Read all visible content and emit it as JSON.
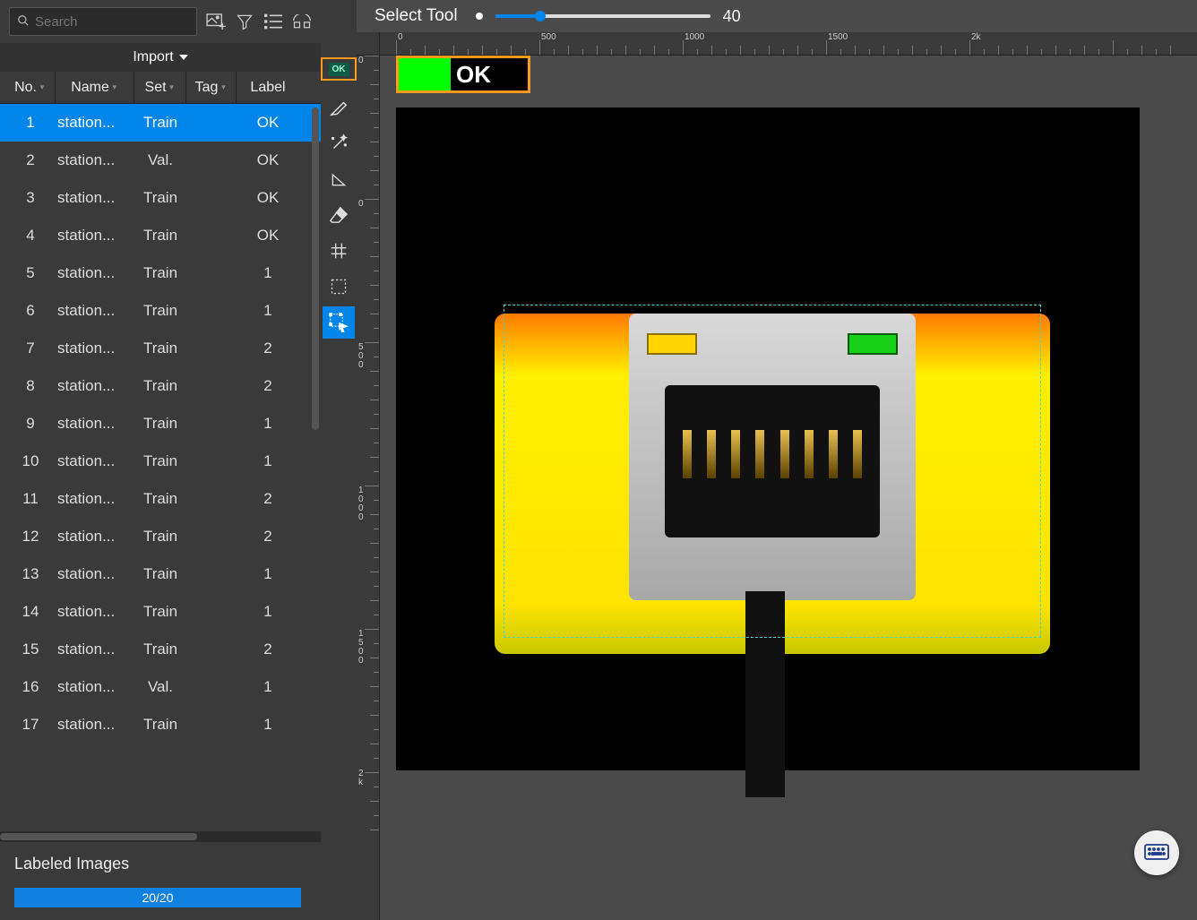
{
  "search": {
    "placeholder": "Search"
  },
  "import_label": "Import",
  "columns": {
    "no": "No.",
    "name": "Name",
    "set": "Set",
    "tag": "Tag",
    "label": "Label"
  },
  "rows": [
    {
      "no": 1,
      "name": "station...",
      "set": "Train",
      "tag": "",
      "label": "OK",
      "selected": true
    },
    {
      "no": 2,
      "name": "station...",
      "set": "Val.",
      "tag": "",
      "label": "OK"
    },
    {
      "no": 3,
      "name": "station...",
      "set": "Train",
      "tag": "",
      "label": "OK"
    },
    {
      "no": 4,
      "name": "station...",
      "set": "Train",
      "tag": "",
      "label": "OK"
    },
    {
      "no": 5,
      "name": "station...",
      "set": "Train",
      "tag": "",
      "label": "1"
    },
    {
      "no": 6,
      "name": "station...",
      "set": "Train",
      "tag": "",
      "label": "1"
    },
    {
      "no": 7,
      "name": "station...",
      "set": "Train",
      "tag": "",
      "label": "2"
    },
    {
      "no": 8,
      "name": "station...",
      "set": "Train",
      "tag": "",
      "label": "2"
    },
    {
      "no": 9,
      "name": "station...",
      "set": "Train",
      "tag": "",
      "label": "1"
    },
    {
      "no": 10,
      "name": "station...",
      "set": "Train",
      "tag": "",
      "label": "1"
    },
    {
      "no": 11,
      "name": "station...",
      "set": "Train",
      "tag": "",
      "label": "2"
    },
    {
      "no": 12,
      "name": "station...",
      "set": "Train",
      "tag": "",
      "label": "2"
    },
    {
      "no": 13,
      "name": "station...",
      "set": "Train",
      "tag": "",
      "label": "1"
    },
    {
      "no": 14,
      "name": "station...",
      "set": "Train",
      "tag": "",
      "label": "1"
    },
    {
      "no": 15,
      "name": "station...",
      "set": "Train",
      "tag": "",
      "label": "2"
    },
    {
      "no": 16,
      "name": "station...",
      "set": "Val.",
      "tag": "",
      "label": "1"
    },
    {
      "no": 17,
      "name": "station...",
      "set": "Train",
      "tag": "",
      "label": "1"
    }
  ],
  "labeled": {
    "title": "Labeled Images",
    "text": "20/20"
  },
  "toolbar_badge": "OK",
  "canvas": {
    "tool_name": "Select Tool",
    "slider_value": "40",
    "ruler_h": [
      "0",
      "500",
      "1000",
      "1500",
      "2k"
    ],
    "ruler_v_labels": [
      {
        "pos": 0,
        "d": [
          "0"
        ]
      },
      {
        "pos": 160,
        "d": [
          "0"
        ]
      },
      {
        "pos": 320,
        "d": [
          "5",
          "0",
          "0"
        ]
      },
      {
        "pos": 480,
        "d": [
          "1",
          "0",
          "0",
          "0"
        ]
      },
      {
        "pos": 640,
        "d": [
          "1",
          "5",
          "0",
          "0"
        ]
      },
      {
        "pos": 796,
        "d": [
          "2",
          "k"
        ]
      }
    ],
    "label_box": "OK"
  }
}
